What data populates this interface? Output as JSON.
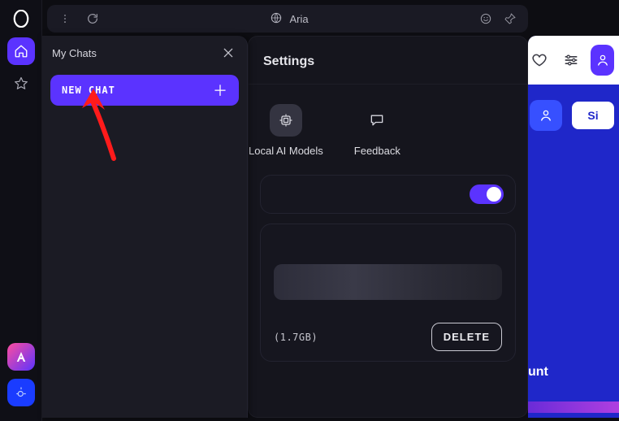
{
  "address": {
    "title": "Aria"
  },
  "top_icons": {
    "heart": "heart",
    "filters": "filters",
    "user": "user"
  },
  "chats": {
    "panel_title": "My Chats",
    "new_chat_label": "NEW CHAT"
  },
  "settings": {
    "title": "Settings",
    "tabs": {
      "models": "Local AI Models",
      "feedback": "Feedback"
    },
    "toggle_on": true,
    "model_size": "(1.7GB)",
    "delete_label": "DELETE"
  },
  "bg": {
    "si_label": "Si",
    "unt_fragment": "unt"
  },
  "colors": {
    "accent": "#5b33ff",
    "red": "#ff1b1b"
  }
}
